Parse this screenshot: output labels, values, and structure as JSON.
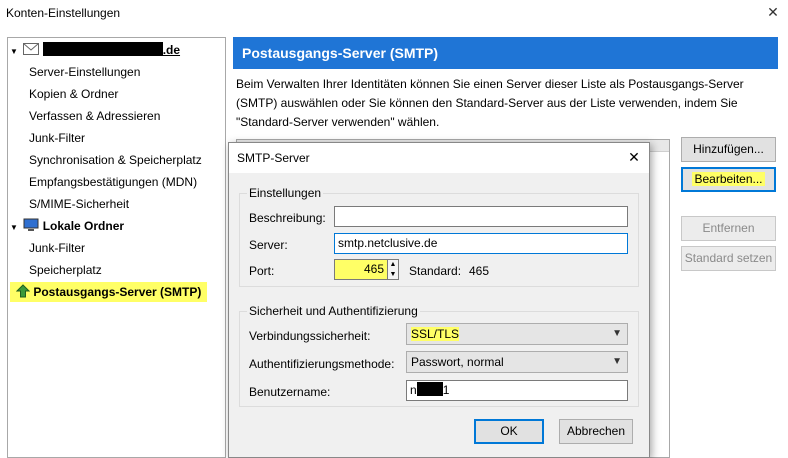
{
  "window": {
    "title": "Konten-Einstellungen",
    "close_glyph": "✕"
  },
  "tree": {
    "account_suffix": ".de",
    "account_children": [
      "Server-Einstellungen",
      "Kopien & Ordner",
      "Verfassen & Adressieren",
      "Junk-Filter",
      "Synchronisation & Speicherplatz",
      "Empfangsbestätigungen (MDN)",
      "S/MIME-Sicherheit"
    ],
    "local_folders": "Lokale Ordner",
    "local_children": [
      "Junk-Filter",
      "Speicherplatz"
    ],
    "smtp_item": "Postausgangs-Server (SMTP)",
    "icons": {
      "account": "mail-envelope-icon",
      "local": "computer-icon",
      "smtp": "upload-arrow-icon",
      "expand": "chevron-down-icon"
    }
  },
  "panel": {
    "title": "Postausgangs-Server (SMTP)",
    "description": "Beim Verwalten Ihrer Identitäten können Sie einen Server dieser Liste als Postausgangs-Server (SMTP) auswählen oder Sie können den Standard-Server aus der Liste verwenden, indem Sie \"Standard-Server verwenden\" wählen.",
    "buttons": {
      "add": "Hinzufügen...",
      "edit": "Bearbeiten...",
      "remove": "Entfernen",
      "default": "Standard setzen"
    }
  },
  "dialog": {
    "title": "SMTP-Server",
    "close_glyph": "✕",
    "settings_group": "Einstellungen",
    "description_label": "Beschreibung:",
    "description_value": "",
    "server_label": "Server:",
    "server_value": "smtp.netclusive.de",
    "port_label": "Port:",
    "port_value": "465",
    "standard_label": "Standard:",
    "standard_value": "465",
    "security_group": "Sicherheit und Authentifizierung",
    "connection_label": "Verbindungssicherheit:",
    "connection_value": "SSL/TLS",
    "auth_label": "Authentifizierungsmethode:",
    "auth_value": "Passwort, normal",
    "username_label": "Benutzername:",
    "username_prefix": "n",
    "username_suffix": "1",
    "ok": "OK",
    "cancel": "Abbrechen"
  },
  "colors": {
    "accent": "#1f75d6",
    "highlight": "#ffff66",
    "focus": "#0078d7"
  }
}
